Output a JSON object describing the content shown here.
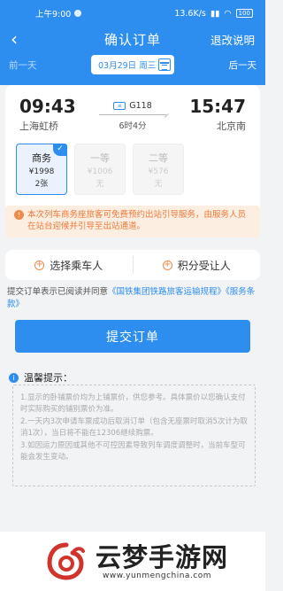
{
  "status": {
    "time": "上午9:00",
    "speed": "13.6K/s",
    "battery": "100"
  },
  "nav": {
    "title": "确认订单",
    "refund": "退改说明"
  },
  "datebar": {
    "prev": "前一天",
    "date": "03月29日 周三",
    "next": "后一天"
  },
  "train": {
    "depart_time": "09:43",
    "depart_station": "上海虹桥",
    "code": "G118",
    "duration": "6时4分",
    "arrive_time": "15:47",
    "arrive_station": "北京南"
  },
  "seats": [
    {
      "class": "商务",
      "price": "¥1998",
      "remain": "2张",
      "selected": true
    },
    {
      "class": "一等",
      "price": "¥1006",
      "remain": "无",
      "selected": false
    },
    {
      "class": "二等",
      "price": "¥576",
      "remain": "无",
      "selected": false
    }
  ],
  "notice": "本次列车商务座旅客可免费预约出站引导服务，由服务人员在站台迎候并引导至出站通道。",
  "actions": {
    "passenger": "选择乘车人",
    "points": "积分受让人"
  },
  "agreement": {
    "prefix": "提交订单表示已阅读并同意",
    "link1": "《国铁集团铁路旅客运输规程》",
    "link2": "《服务条款》"
  },
  "submit_label": "提交订单",
  "tips": {
    "title": "温馨提示：",
    "items": [
      "1.显示的卧铺票价均为上铺票价，供您参考。具体票价以您确认支付时实际购买的铺别票价为准。",
      "2.一天内3次申请车票成功后取消订单（包含无座票时取消5次计为取消1次），当日将不能在12306继续购票。",
      "3.如因运力原因或其他不可控因素导致列车调度调整时，当前车型可能会发生变动。"
    ]
  },
  "watermark": {
    "title": "云梦手游网",
    "url": "www.yunmengchina.com"
  },
  "colors": {
    "primary": "#2e8ef0",
    "warning": "#f08a4b"
  }
}
